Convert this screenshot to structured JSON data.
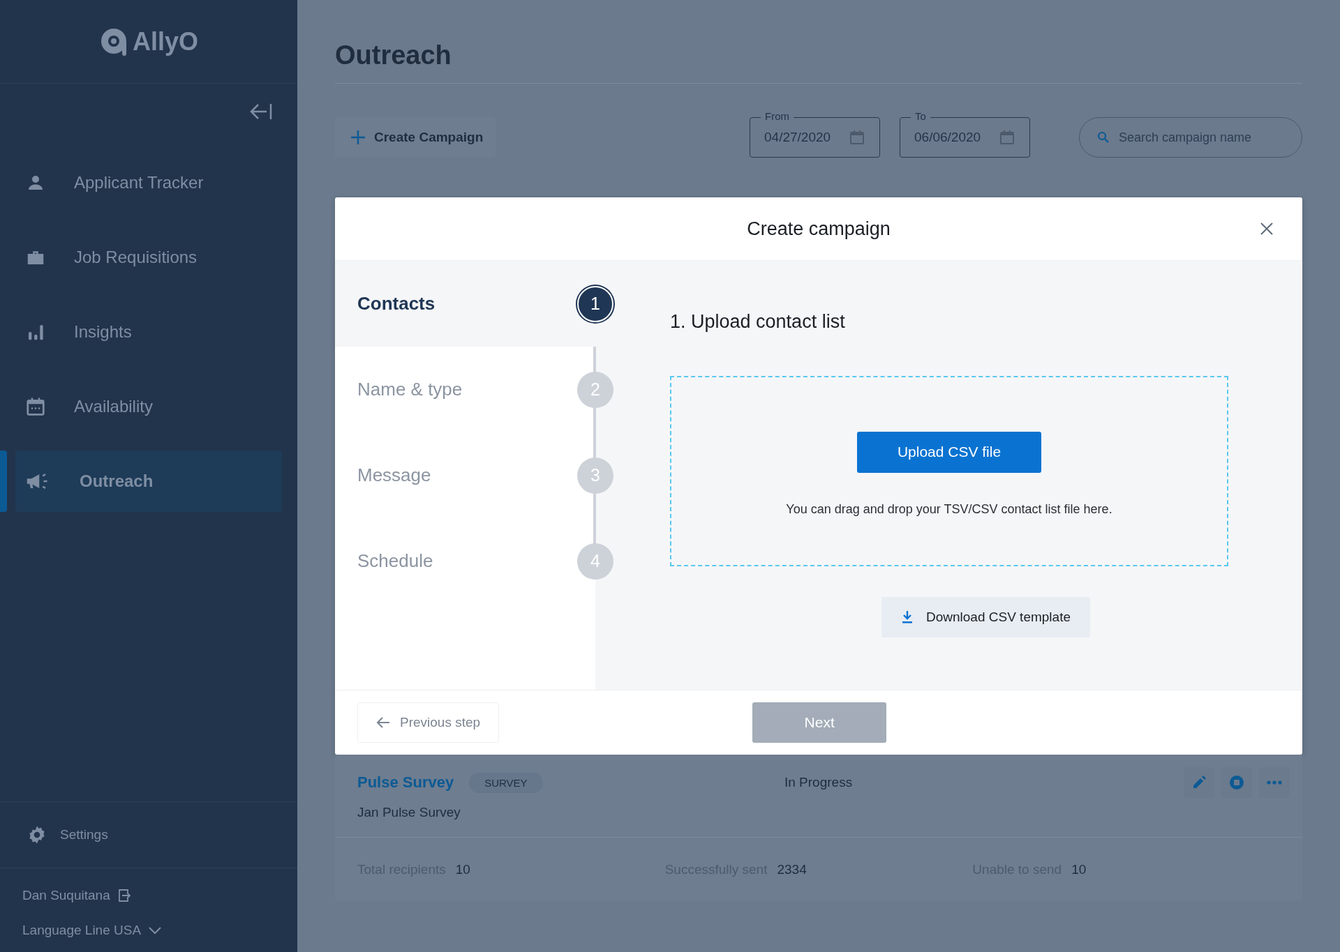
{
  "sidebar": {
    "logo": "AllyO",
    "items": [
      {
        "label": "Applicant Tracker",
        "selected": false
      },
      {
        "label": "Job Requisitions",
        "selected": false
      },
      {
        "label": "Insights",
        "selected": false
      },
      {
        "label": "Availability",
        "selected": false
      },
      {
        "label": "Outreach",
        "selected": true
      }
    ],
    "settings": "Settings",
    "user": "Dan Suquitana",
    "organization": "Language Line USA"
  },
  "page": {
    "title": "Outreach",
    "create_button": "Create Campaign",
    "date_fields": [
      {
        "label": "From",
        "value": "04/27/2020"
      },
      {
        "label": "To",
        "value": "06/06/2020"
      }
    ],
    "search": {
      "placeholder": "Search campaign name"
    }
  },
  "modal": {
    "title": "Create campaign",
    "steps": [
      {
        "label": "Contacts",
        "number": "1",
        "selected": true
      },
      {
        "label": "Name & type",
        "number": "2",
        "selected": false
      },
      {
        "label": "Message",
        "number": "3",
        "selected": false
      },
      {
        "label": "Schedule",
        "number": "4",
        "selected": false
      }
    ],
    "section_title": "1. Upload contact list",
    "upload_button": "Upload CSV file",
    "drop_hint": "You can drag and drop your TSV/CSV contact list file here.",
    "download_button": "Download CSV template",
    "previous_button": "Previous step",
    "next_button": "Next",
    "next_disabled": true
  },
  "campaign": {
    "name": "Pulse Survey",
    "tag": "SURVEY",
    "status": "In Progress",
    "description": "Jan Pulse Survey",
    "stats": [
      {
        "label": "Total recipients",
        "value": "10"
      },
      {
        "label": "Successfully sent",
        "value": "2334"
      },
      {
        "label": "Unable to send",
        "value": "10"
      }
    ]
  }
}
